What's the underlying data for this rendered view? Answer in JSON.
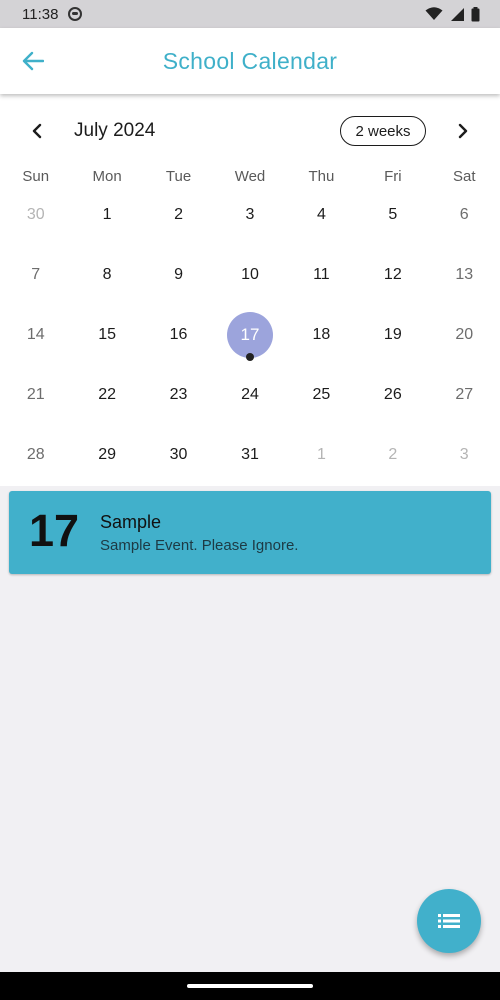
{
  "status_bar": {
    "time": "11:38"
  },
  "app_bar": {
    "title": "School Calendar"
  },
  "calendar": {
    "month_label": "July 2024",
    "format_button": "2 weeks",
    "days_of_week": [
      "Sun",
      "Mon",
      "Tue",
      "Wed",
      "Thu",
      "Fri",
      "Sat"
    ],
    "weeks": [
      [
        {
          "d": "30",
          "outside": true
        },
        {
          "d": "1"
        },
        {
          "d": "2"
        },
        {
          "d": "3"
        },
        {
          "d": "4"
        },
        {
          "d": "5"
        },
        {
          "d": "6"
        }
      ],
      [
        {
          "d": "7"
        },
        {
          "d": "8"
        },
        {
          "d": "9"
        },
        {
          "d": "10"
        },
        {
          "d": "11"
        },
        {
          "d": "12"
        },
        {
          "d": "13"
        }
      ],
      [
        {
          "d": "14"
        },
        {
          "d": "15"
        },
        {
          "d": "16"
        },
        {
          "d": "17",
          "selected": true,
          "event": true
        },
        {
          "d": "18"
        },
        {
          "d": "19"
        },
        {
          "d": "20"
        }
      ],
      [
        {
          "d": "21"
        },
        {
          "d": "22"
        },
        {
          "d": "23"
        },
        {
          "d": "24"
        },
        {
          "d": "25"
        },
        {
          "d": "26"
        },
        {
          "d": "27"
        }
      ],
      [
        {
          "d": "28"
        },
        {
          "d": "29"
        },
        {
          "d": "30"
        },
        {
          "d": "31"
        },
        {
          "d": "1",
          "outside": true
        },
        {
          "d": "2",
          "outside": true
        },
        {
          "d": "3",
          "outside": true
        }
      ]
    ],
    "selected_color": "#9ca4dc"
  },
  "event": {
    "day": "17",
    "title": "Sample",
    "description": "Sample Event. Please Ignore."
  },
  "colors": {
    "accent": "#41b0cb",
    "title": "#3fb0c9",
    "background": "#f1f0f3"
  },
  "icons": {
    "back": "arrow-left-icon",
    "prev": "chevron-left-icon",
    "next": "chevron-right-icon",
    "fab": "list-icon"
  }
}
